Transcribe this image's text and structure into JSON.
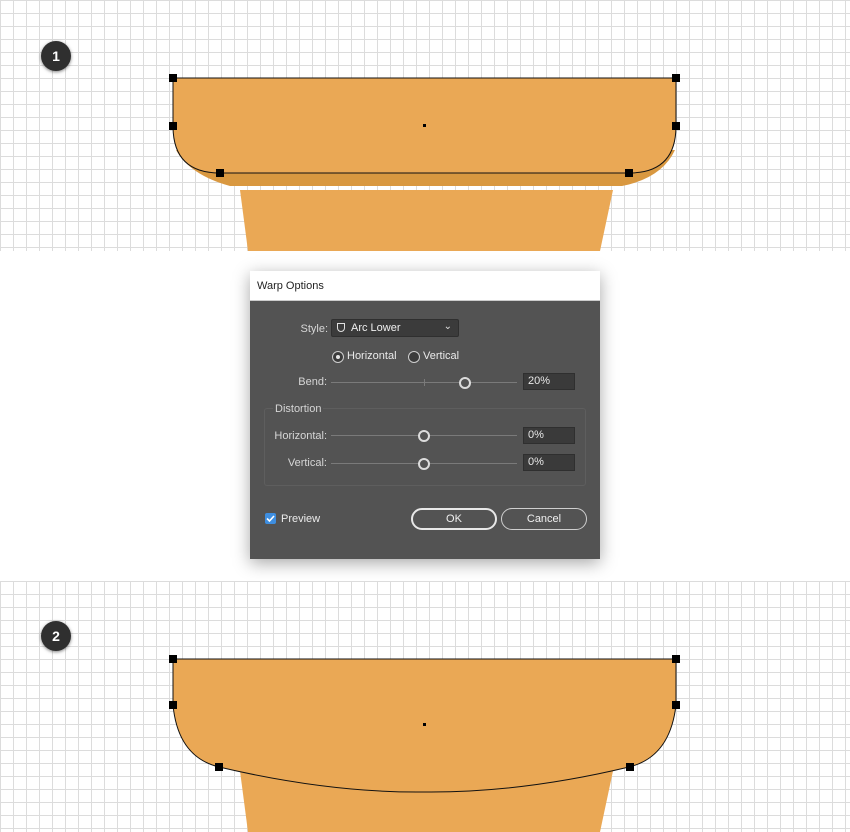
{
  "steps": {
    "first": "1",
    "second": "2"
  },
  "colors": {
    "shape_fill": "#EAA855",
    "shape_shadow": "#D99840",
    "anchor": "#000000",
    "dialog_bg": "#535353",
    "accent": "#3E8EE0"
  },
  "dialog": {
    "title": "Warp Options",
    "style_label": "Style:",
    "style_icon": "arc-lower-icon",
    "style_value": "Arc Lower",
    "orientation": {
      "horizontal": "Horizontal",
      "vertical": "Vertical",
      "selected": "horizontal"
    },
    "bend": {
      "label": "Bend:",
      "value": "20%",
      "slider_level": 20
    },
    "distortion": {
      "title": "Distortion",
      "horizontal": {
        "label": "Horizontal:",
        "value": "0%",
        "slider_level": 0
      },
      "vertical": {
        "label": "Vertical:",
        "value": "0%",
        "slider_level": 0
      }
    },
    "preview": {
      "label": "Preview",
      "checked": true
    },
    "ok_label": "OK",
    "cancel_label": "Cancel"
  }
}
